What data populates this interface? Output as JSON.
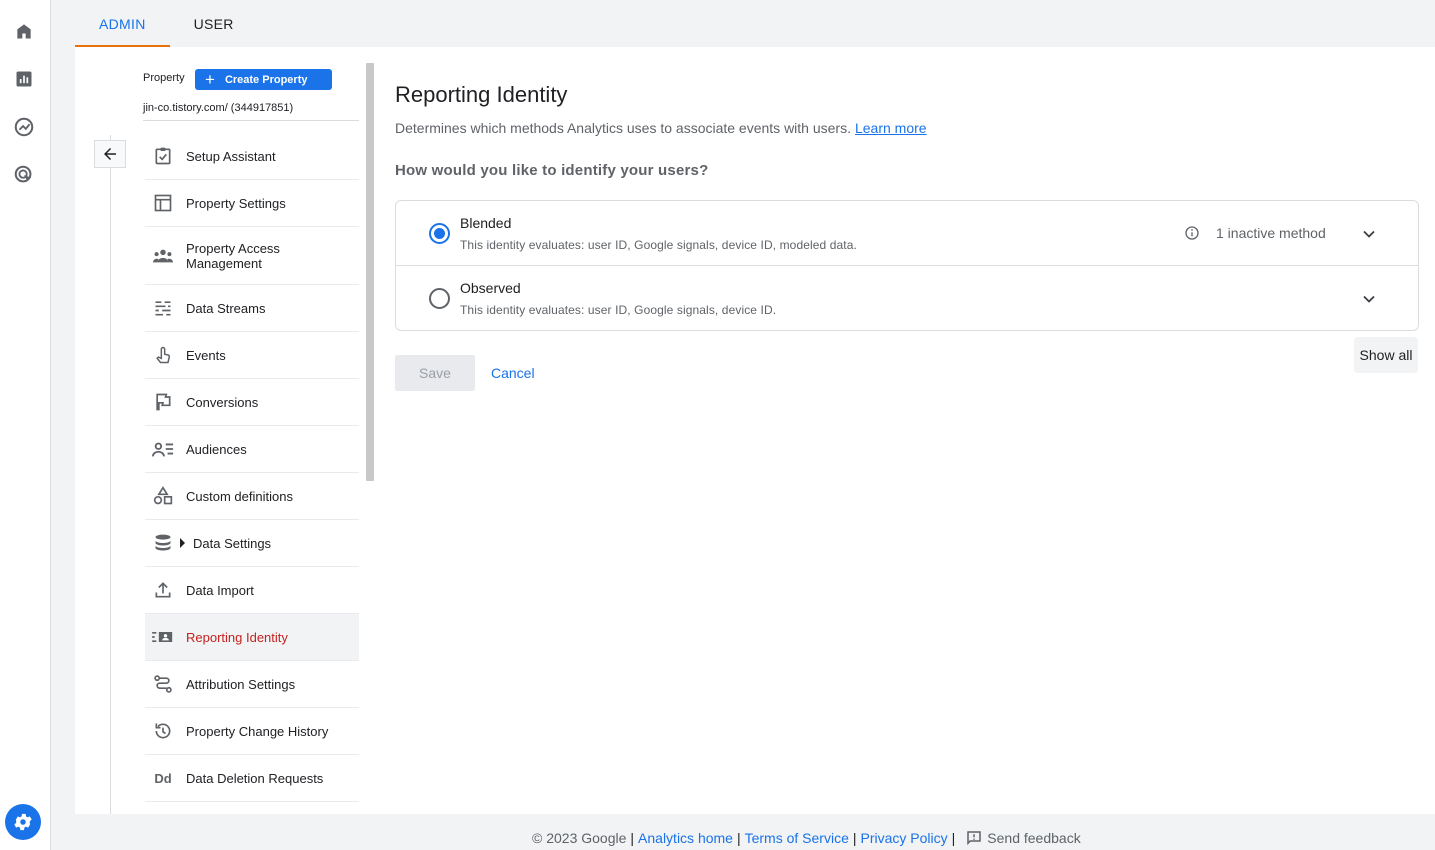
{
  "tabs": [
    {
      "label": "ADMIN"
    },
    {
      "label": "USER"
    }
  ],
  "rail": {
    "icons": [
      "home-icon",
      "reports-icon",
      "explore-icon",
      "advertising-icon"
    ],
    "settings_icon": "gear-icon"
  },
  "property": {
    "label": "Property",
    "create_label": "Create Property",
    "id_text": "jin-co.tistory.com/ (344917851)"
  },
  "nav": {
    "items": [
      {
        "label": "Setup Assistant",
        "icon": "checklist-icon"
      },
      {
        "label": "Property Settings",
        "icon": "layout-icon"
      },
      {
        "label": "Property Access Management",
        "icon": "people-icon"
      },
      {
        "label": "Data Streams",
        "icon": "streams-icon"
      },
      {
        "label": "Events",
        "icon": "touch-icon"
      },
      {
        "label": "Conversions",
        "icon": "flag-icon"
      },
      {
        "label": "Audiences",
        "icon": "audience-icon"
      },
      {
        "label": "Custom definitions",
        "icon": "shapes-icon"
      },
      {
        "label": "Data Settings",
        "icon": "database-icon"
      },
      {
        "label": "Data Import",
        "icon": "upload-icon"
      },
      {
        "label": "Reporting Identity",
        "icon": "identity-icon"
      },
      {
        "label": "Attribution Settings",
        "icon": "attribution-icon"
      },
      {
        "label": "Property Change History",
        "icon": "history-icon"
      },
      {
        "label": "Data Deletion Requests",
        "icon": "Dd"
      }
    ],
    "active": "Reporting Identity"
  },
  "main": {
    "title": "Reporting Identity",
    "description": "Determines which methods Analytics uses to associate events with users.",
    "learn_more": "Learn more",
    "question": "How would you like to identify your users?",
    "options": [
      {
        "title": "Blended",
        "subtitle": "This identity evaluates: user ID, Google signals, device ID, modeled data.",
        "selected": true,
        "info": "1 inactive method"
      },
      {
        "title": "Observed",
        "subtitle": "This identity evaluates: user ID, Google signals, device ID.",
        "selected": false
      }
    ],
    "show_all": "Show all",
    "save": "Save",
    "cancel": "Cancel"
  },
  "footer": {
    "copyright": "© 2023 Google",
    "links": [
      "Analytics home",
      "Terms of Service",
      "Privacy Policy"
    ],
    "feedback": "Send feedback"
  },
  "colors": {
    "accent": "#1a73e8",
    "active_nav": "#c5221f",
    "tab_indicator": "#e8710a"
  }
}
